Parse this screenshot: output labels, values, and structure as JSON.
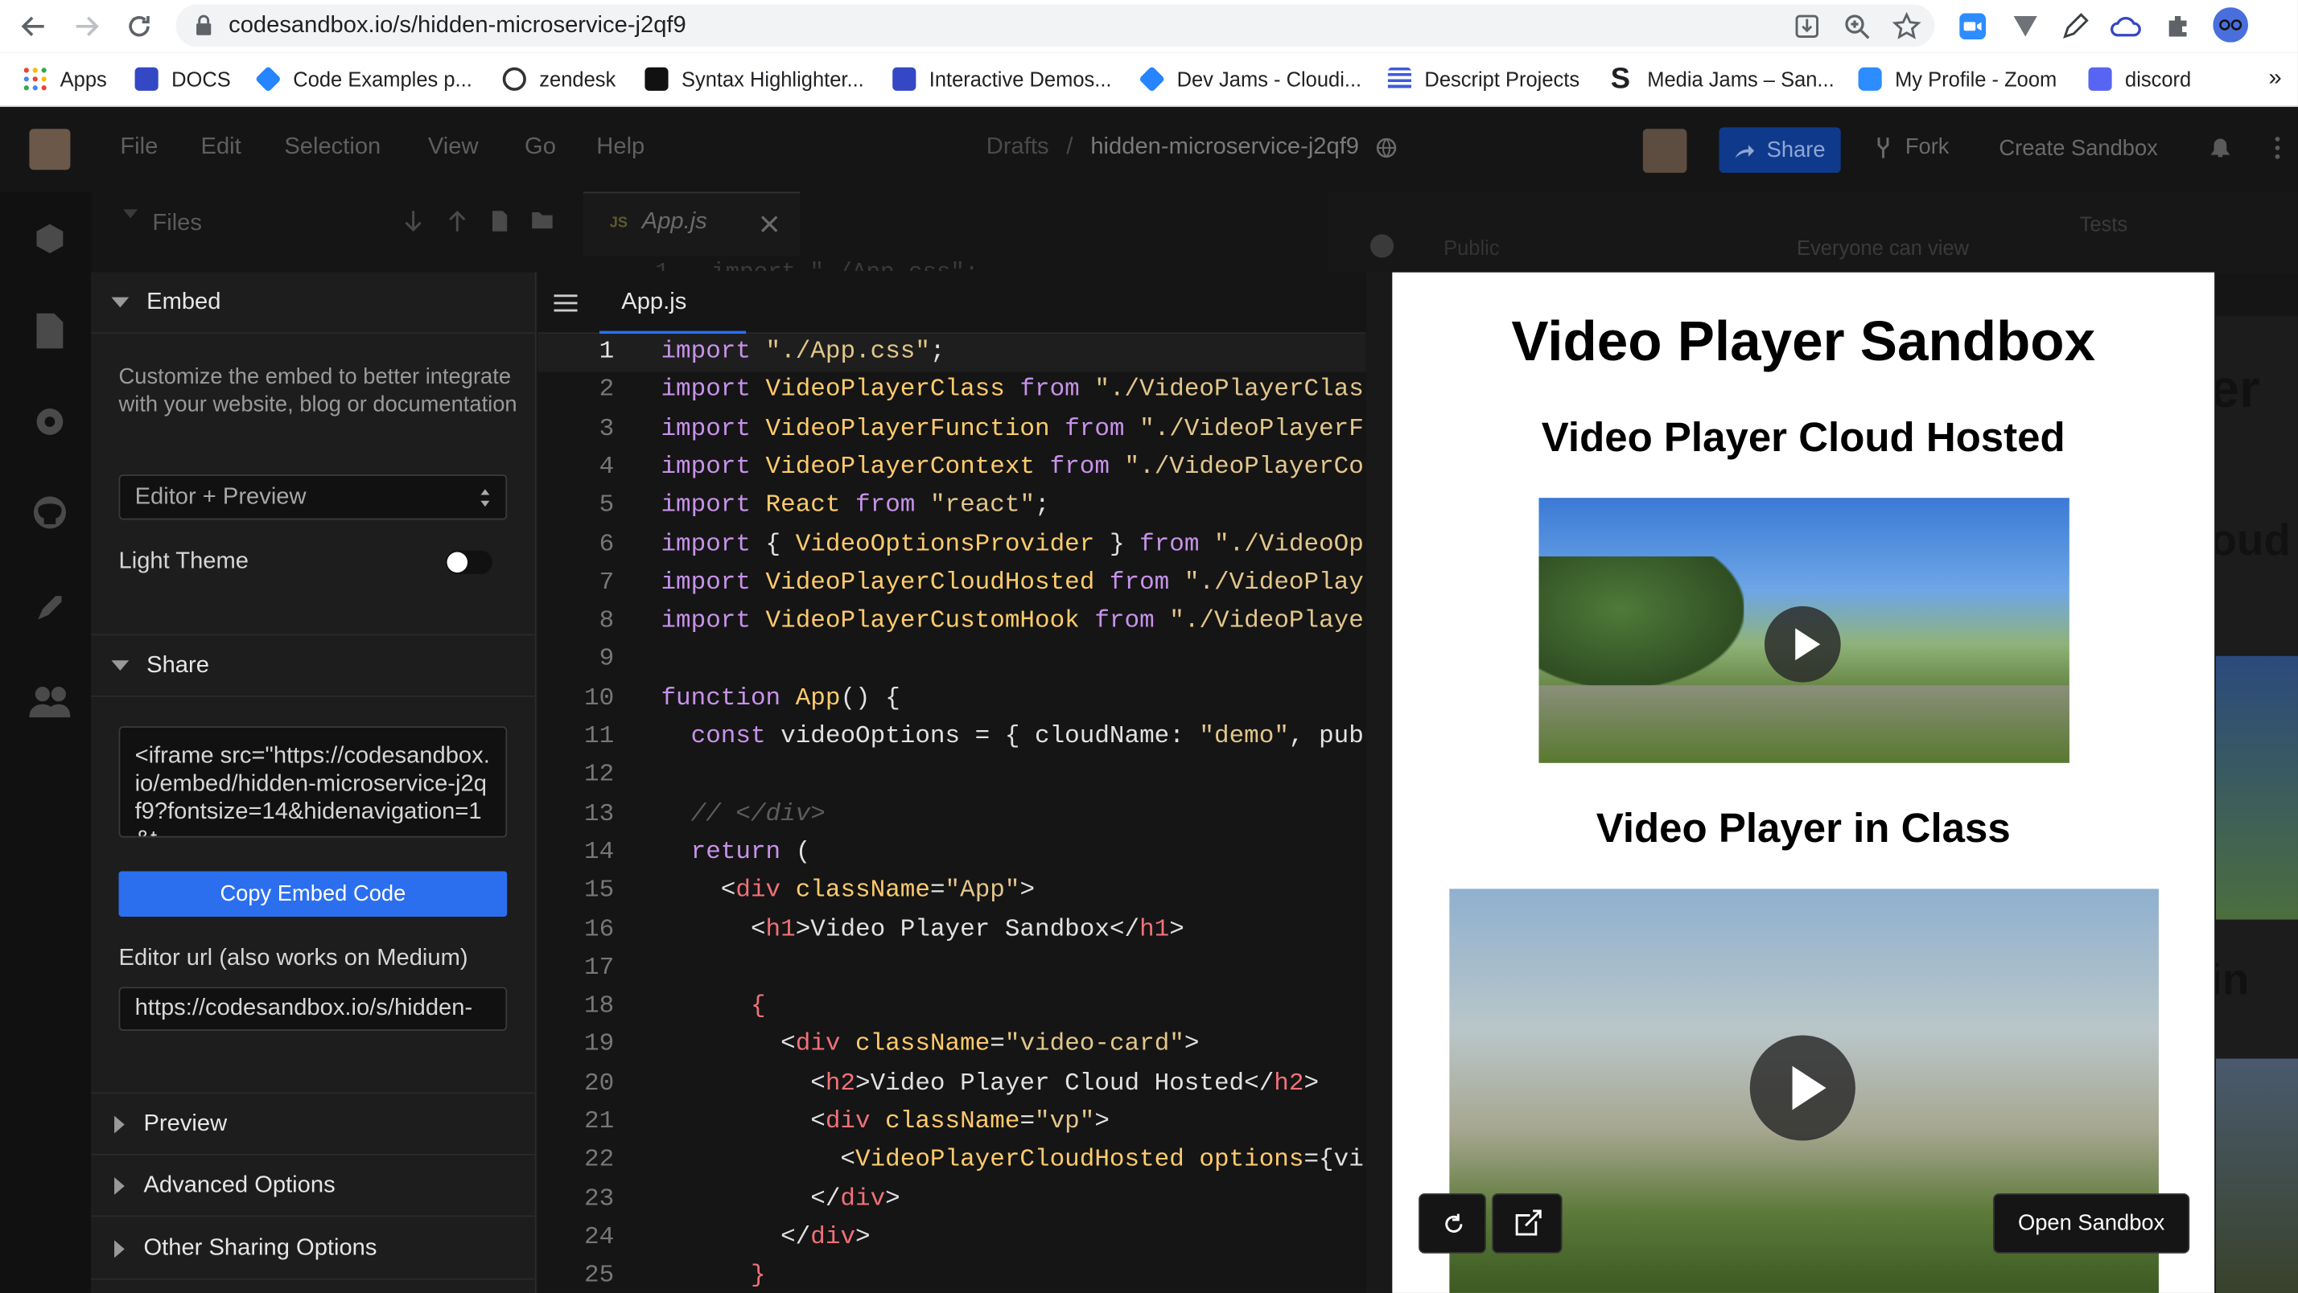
{
  "browser": {
    "url": "codesandbox.io/s/hidden-microservice-j2qf9",
    "bookmarks": [
      {
        "label": "Apps",
        "icon": "apps-grid-icon"
      },
      {
        "label": "DOCS",
        "icon": "cloudinary-icon"
      },
      {
        "label": "Code Examples p...",
        "icon": "confluence-icon"
      },
      {
        "label": "zendesk",
        "icon": "zendesk-icon"
      },
      {
        "label": "Syntax Highlighter...",
        "icon": "syntax-icon"
      },
      {
        "label": "Interactive Demos...",
        "icon": "cloudinary-icon"
      },
      {
        "label": "Dev Jams - Cloudi...",
        "icon": "confluence-icon"
      },
      {
        "label": "Descript Projects",
        "icon": "descript-icon"
      },
      {
        "label": "Media Jams – San...",
        "icon": "sanity-icon"
      },
      {
        "label": "My Profile - Zoom",
        "icon": "zoom-icon"
      },
      {
        "label": "discord",
        "icon": "discord-icon"
      }
    ],
    "more": "»"
  },
  "app": {
    "menu": [
      "File",
      "Edit",
      "Selection",
      "View",
      "Go",
      "Help"
    ],
    "breadcrumb": {
      "folder": "Drafts",
      "sep": "/",
      "name": "hidden-microservice-j2qf9"
    },
    "share_label": "Share",
    "fork_label": "Fork",
    "create_label": "Create Sandbox",
    "files_label": "Files",
    "tab_label": "App.js",
    "tab_prefix": "JS",
    "bg_code_line": "1   import \"./App.css\";",
    "bg_visibility": "Public",
    "bg_visibility_desc": "Everyone can view",
    "bg_tests": "Tests"
  },
  "embed": {
    "section_title": "Embed",
    "description": "Customize the embed to better integrate with your website, blog or documentation",
    "mode_select": "Editor + Preview",
    "light_theme_label": "Light Theme",
    "light_theme_on": false,
    "share_title": "Share",
    "iframe_code": "<iframe src=\"https://codesandbox.io/embed/hidden-microservice-j2qf9?fontsize=14&hidenavigation=1&t",
    "copy_button": "Copy Embed Code",
    "editor_url_label": "Editor url (also works on Medium)",
    "editor_url": "https://codesandbox.io/s/hidden-",
    "collapsed_sections": [
      "Preview",
      "Advanced Options",
      "Other Sharing Options"
    ]
  },
  "editor": {
    "tab": "App.js",
    "lines": [
      [
        [
          "kw",
          "import "
        ],
        [
          "st",
          "\"./App.css\""
        ],
        [
          "pl",
          ";"
        ]
      ],
      [
        [
          "kw",
          "import "
        ],
        [
          "id",
          "VideoPlayerClass "
        ],
        [
          "kw",
          "from "
        ],
        [
          "st",
          "\"./VideoPlayerClas"
        ]
      ],
      [
        [
          "kw",
          "import "
        ],
        [
          "id",
          "VideoPlayerFunction "
        ],
        [
          "kw",
          "from "
        ],
        [
          "st",
          "\"./VideoPlayerF"
        ]
      ],
      [
        [
          "kw",
          "import "
        ],
        [
          "id",
          "VideoPlayerContext "
        ],
        [
          "kw",
          "from "
        ],
        [
          "st",
          "\"./VideoPlayerCo"
        ]
      ],
      [
        [
          "kw",
          "import "
        ],
        [
          "id",
          "React "
        ],
        [
          "kw",
          "from "
        ],
        [
          "st",
          "\"react\""
        ],
        [
          "pl",
          ";"
        ]
      ],
      [
        [
          "kw",
          "import "
        ],
        [
          "pl",
          "{ "
        ],
        [
          "id",
          "VideoOptionsProvider "
        ],
        [
          "pl",
          "} "
        ],
        [
          "kw",
          "from "
        ],
        [
          "st",
          "\"./VideoOp"
        ]
      ],
      [
        [
          "kw",
          "import "
        ],
        [
          "id",
          "VideoPlayerCloudHosted "
        ],
        [
          "kw",
          "from "
        ],
        [
          "st",
          "\"./VideoPlay"
        ]
      ],
      [
        [
          "kw",
          "import "
        ],
        [
          "id",
          "VideoPlayerCustomHook "
        ],
        [
          "kw",
          "from "
        ],
        [
          "st",
          "\"./VideoPlaye"
        ]
      ],
      [],
      [
        [
          "kw",
          "function "
        ],
        [
          "id",
          "App"
        ],
        [
          "pl",
          "() {"
        ]
      ],
      [
        [
          "pl",
          "  "
        ],
        [
          "kw",
          "const "
        ],
        [
          "pl",
          "videoOptions = { cloudName: "
        ],
        [
          "st",
          "\"demo\""
        ],
        [
          "pl",
          ", pub"
        ]
      ],
      [],
      [
        [
          "cm",
          "  // </div>"
        ]
      ],
      [
        [
          "kw",
          "  return "
        ],
        [
          "pl",
          "("
        ]
      ],
      [
        [
          "pl",
          "    <"
        ],
        [
          "tg",
          "div "
        ],
        [
          "at",
          "className"
        ],
        [
          "pl",
          "="
        ],
        [
          "st",
          "\"App\""
        ],
        [
          "pl",
          ">"
        ]
      ],
      [
        [
          "pl",
          "      <"
        ],
        [
          "tg",
          "h1"
        ],
        [
          "pl",
          ">Video Player Sandbox</"
        ],
        [
          "tg",
          "h1"
        ],
        [
          "pl",
          ">"
        ]
      ],
      [],
      [
        [
          "tg",
          "      {"
        ]
      ],
      [
        [
          "pl",
          "        <"
        ],
        [
          "tg",
          "div "
        ],
        [
          "at",
          "className"
        ],
        [
          "pl",
          "="
        ],
        [
          "st",
          "\"video-card\""
        ],
        [
          "pl",
          ">"
        ]
      ],
      [
        [
          "pl",
          "          <"
        ],
        [
          "tg",
          "h2"
        ],
        [
          "pl",
          ">Video Player Cloud Hosted</"
        ],
        [
          "tg",
          "h2"
        ],
        [
          "pl",
          ">"
        ]
      ],
      [
        [
          "pl",
          "          <"
        ],
        [
          "tg",
          "div "
        ],
        [
          "at",
          "className"
        ],
        [
          "pl",
          "="
        ],
        [
          "st",
          "\"vp\""
        ],
        [
          "pl",
          ">"
        ]
      ],
      [
        [
          "pl",
          "            <"
        ],
        [
          "id",
          "VideoPlayerCloudHosted "
        ],
        [
          "at",
          "options"
        ],
        [
          "pl",
          "={vi"
        ]
      ],
      [
        [
          "pl",
          "          </"
        ],
        [
          "tg",
          "div"
        ],
        [
          "pl",
          ">"
        ]
      ],
      [
        [
          "pl",
          "        </"
        ],
        [
          "tg",
          "div"
        ],
        [
          "pl",
          ">"
        ]
      ],
      [
        [
          "tg",
          "      }"
        ]
      ]
    ]
  },
  "preview": {
    "title": "Video Player Sandbox",
    "h2_cloud": "Video Player Cloud Hosted",
    "h2_class": "Video Player in Class",
    "open_sandbox": "Open Sandbox",
    "bg_partial_1": "er",
    "bg_partial_2": "oud",
    "bg_partial_3": "in"
  },
  "colors": {
    "accent_blue": "#2b6fef",
    "share_button": "#0f3a8c",
    "editor_bg": "#151515"
  }
}
